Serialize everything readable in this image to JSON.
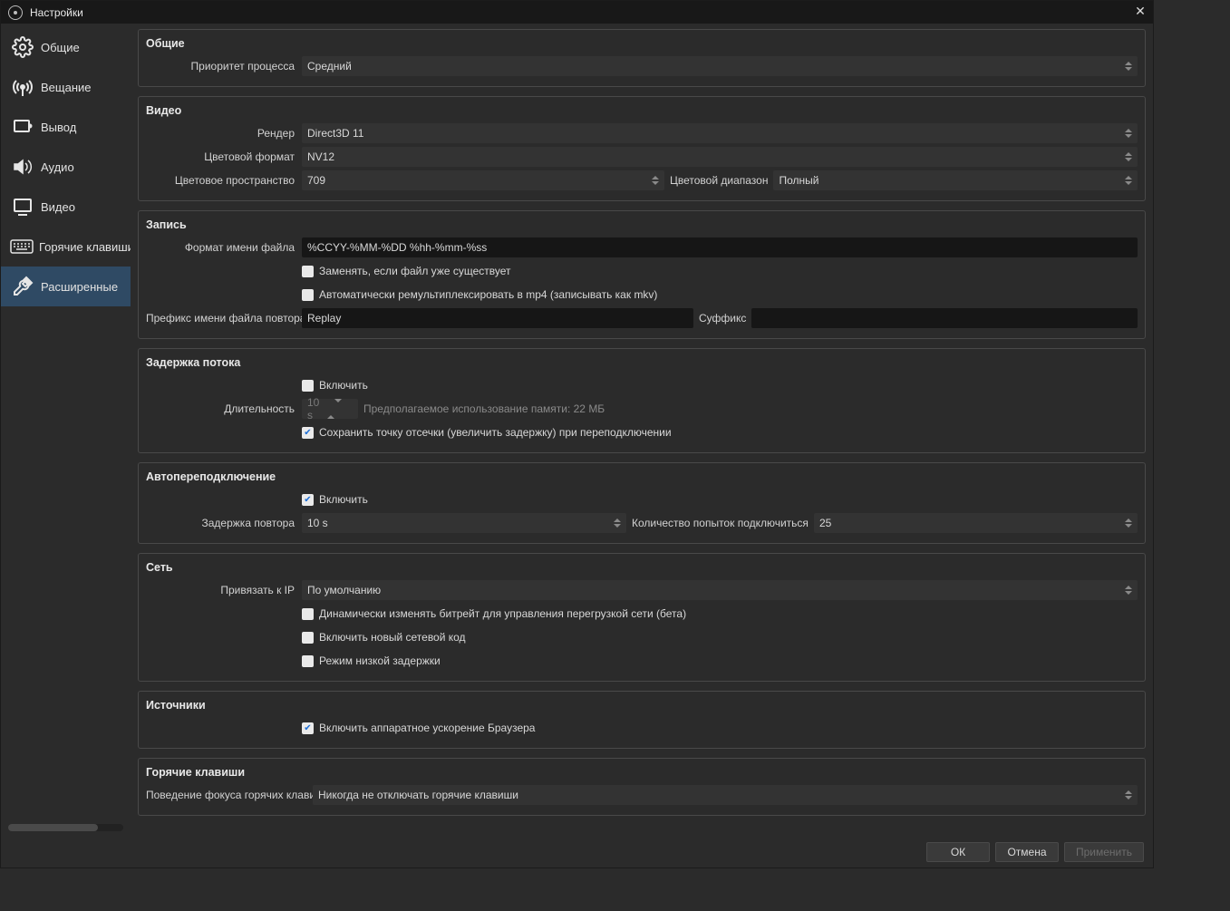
{
  "window": {
    "title": "Настройки"
  },
  "sidebar": {
    "items": [
      {
        "label": "Общие"
      },
      {
        "label": "Вещание"
      },
      {
        "label": "Вывод"
      },
      {
        "label": "Аудио"
      },
      {
        "label": "Видео"
      },
      {
        "label": "Горячие клавиши"
      },
      {
        "label": "Расширенные"
      }
    ]
  },
  "sections": {
    "general": {
      "title": "Общие",
      "process_priority_label": "Приоритет процесса",
      "process_priority_value": "Средний"
    },
    "video": {
      "title": "Видео",
      "renderer_label": "Рендер",
      "renderer_value": "Direct3D 11",
      "color_format_label": "Цветовой формат",
      "color_format_value": "NV12",
      "color_space_label": "Цветовое пространство",
      "color_space_value": "709",
      "color_range_label": "Цветовой диапазон",
      "color_range_value": "Полный"
    },
    "recording": {
      "title": "Запись",
      "filename_format_label": "Формат имени файла",
      "filename_format_value": "%CCYY-%MM-%DD %hh-%mm-%ss",
      "overwrite_label": "Заменять, если файл уже существует",
      "remux_label": "Автоматически ремультиплексировать в mp4 (записывать как mkv)",
      "replay_prefix_label": "Префикс имени файла повтора",
      "replay_prefix_value": "Replay",
      "suffix_label": "Суффикс",
      "suffix_value": ""
    },
    "delay": {
      "title": "Задержка потока",
      "enable_label": "Включить",
      "duration_label": "Длительность",
      "duration_value": "10 s",
      "memory_label": "Предполагаемое использование памяти: 22 МБ",
      "preserve_label": "Сохранить точку отсечки (увеличить задержку) при переподключении"
    },
    "reconnect": {
      "title": "Автопереподключение",
      "enable_label": "Включить",
      "retry_delay_label": "Задержка повтора",
      "retry_delay_value": "10 s",
      "max_retries_label": "Количество попыток подключиться",
      "max_retries_value": "25"
    },
    "network": {
      "title": "Сеть",
      "bind_ip_label": "Привязать к IP",
      "bind_ip_value": "По умолчанию",
      "dyn_bitrate_label": "Динамически изменять битрейт для управления перегрузкой сети (бета)",
      "new_netcode_label": "Включить новый сетевой код",
      "low_latency_label": "Режим низкой задержки"
    },
    "sources": {
      "title": "Источники",
      "browser_hw_label": "Включить аппаратное ускорение Браузера"
    },
    "hotkeys": {
      "title": "Горячие клавиши",
      "focus_behavior_label": "Поведение фокуса горячих клавиш",
      "focus_behavior_value": "Никогда не отключать горячие клавиши"
    }
  },
  "footer": {
    "ok": "ОК",
    "cancel": "Отмена",
    "apply": "Применить"
  }
}
